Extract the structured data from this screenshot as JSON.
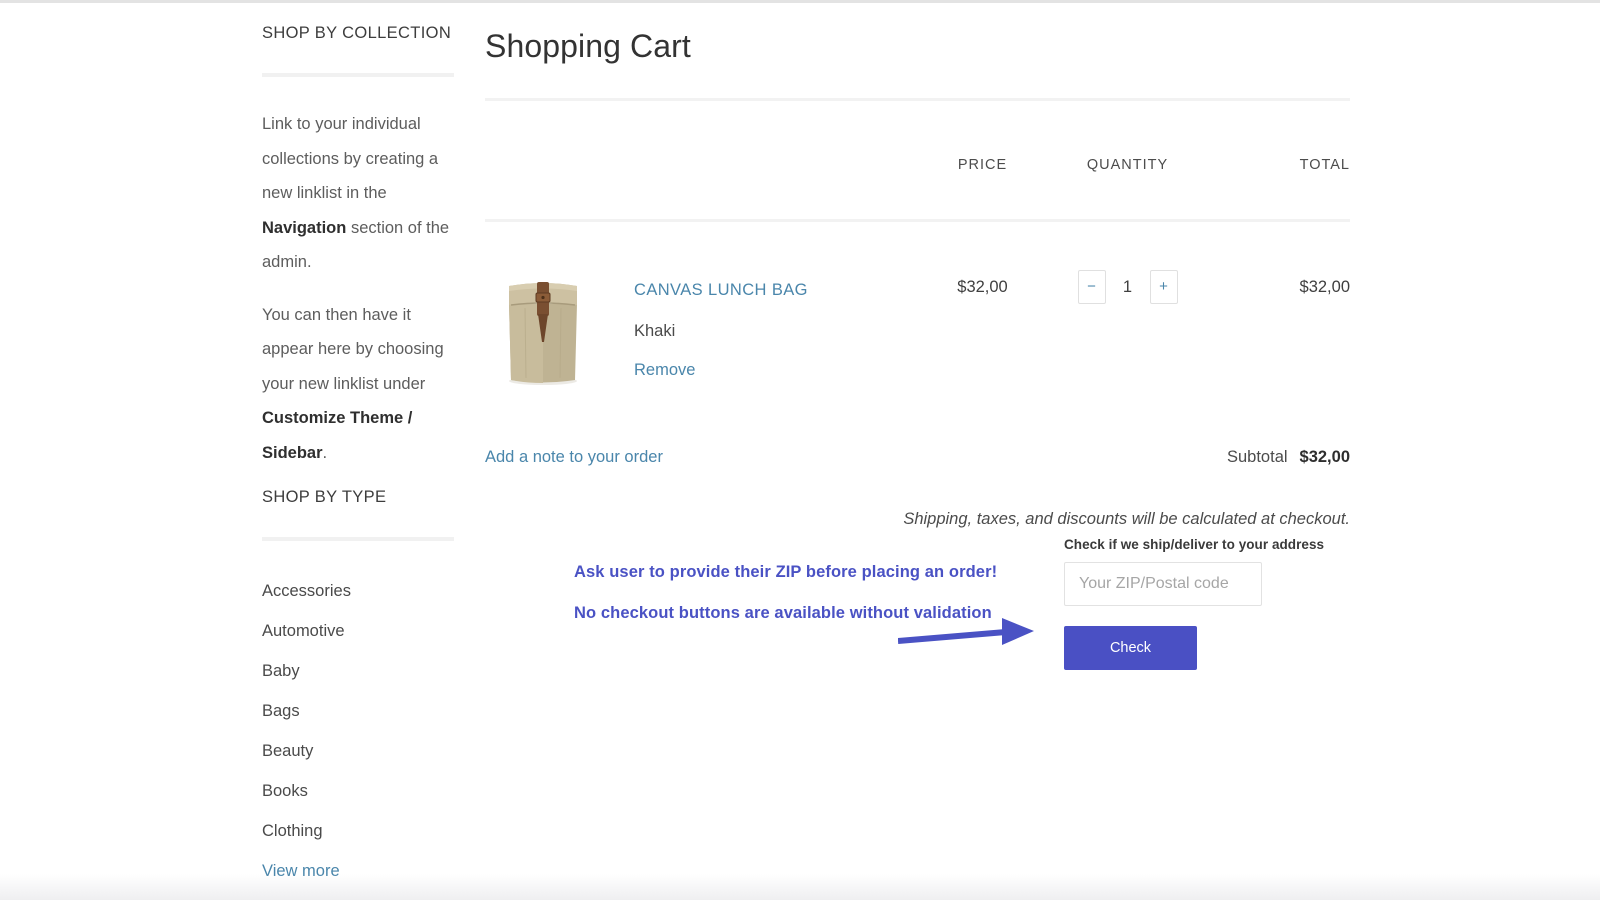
{
  "sidebar": {
    "collection_heading": "SHOP BY COLLECTION",
    "paragraphs": [
      {
        "prefix": "Link to your individual collections by creating a new linklist in the ",
        "bold": "Navigation",
        "suffix": " section of the admin."
      },
      {
        "prefix": "You can then have it appear here by choosing your new linklist under ",
        "bold": "Customize Theme / Sidebar",
        "suffix": "."
      }
    ],
    "type_heading": "SHOP BY TYPE",
    "types": [
      "Accessories",
      "Automotive",
      "Baby",
      "Bags",
      "Beauty",
      "Books",
      "Clothing"
    ],
    "view_more": "View more"
  },
  "cart": {
    "title": "Shopping Cart",
    "columns": {
      "product": "",
      "price": "PRICE",
      "quantity": "QUANTITY",
      "total": "TOTAL"
    },
    "items": [
      {
        "title": "CANVAS LUNCH BAG",
        "variant": "Khaki",
        "remove_label": "Remove",
        "price": "$32,00",
        "qty": "1",
        "decrement_label": "−",
        "increment_label": "+",
        "line_total": "$32,00"
      }
    ],
    "note_link": "Add a note to your order",
    "subtotal_label": "Subtotal",
    "subtotal_value": "$32,00",
    "shipping_note": "Shipping, taxes, and discounts will be calculated at checkout."
  },
  "zip_widget": {
    "label": "Check if we ship/deliver to your address",
    "input_value": "",
    "placeholder": "Your ZIP/Postal code",
    "button_label": "Check"
  },
  "annotations": [
    "Ask user to provide their ZIP before placing an order!",
    "No checkout buttons are available without validation"
  ],
  "colors": {
    "link": "#4a86ab",
    "annotation": "#4a52c4",
    "button": "#4a50c4",
    "text": "#3f3f3f",
    "divider": "#f2f2f2"
  }
}
